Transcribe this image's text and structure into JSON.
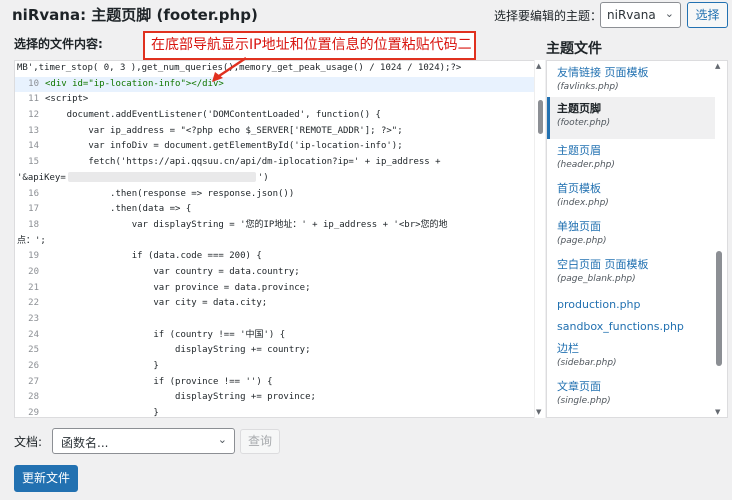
{
  "header": {
    "title": "niRvana: 主题页脚 (footer.php)",
    "theme_select_label": "选择要编辑的主题：",
    "theme_selected": "niRvana",
    "select_button": "选择"
  },
  "editor": {
    "content_label": "选择的文件内容:",
    "annotation": "在底部导航显示IP地址和位置信息的位置粘贴代码二",
    "lines": [
      {
        "num": "",
        "code": "MB',timer_stop( 0, 3 ),get_num_queries(),memory_get_peak_usage() / 1024 / 1024);?>"
      },
      {
        "num": "10",
        "code": "<div id=\"ip-location-info\"></div>",
        "active": true
      },
      {
        "num": "11",
        "code": "<script>"
      },
      {
        "num": "12",
        "code": "    document.addEventListener('DOMContentLoaded', function() {"
      },
      {
        "num": "13",
        "code": "        var ip_address = \"<?php echo $_SERVER['REMOTE_ADDR']; ?>\";"
      },
      {
        "num": "14",
        "code": "        var infoDiv = document.getElementById('ip-location-info');"
      },
      {
        "num": "15",
        "code": "        fetch('https://api.qqsuu.cn/api/dm-iplocation?ip=' + ip_address +"
      },
      {
        "num": "",
        "code": "'&apiKey=",
        "code2": "')",
        "blurred": true
      },
      {
        "num": "16",
        "code": "            .then(response => response.json())"
      },
      {
        "num": "17",
        "code": "            .then(data => {"
      },
      {
        "num": "18",
        "code": "                var displayString = '您的IP地址：' + ip_address + '<br>您的地"
      },
      {
        "num": "",
        "code": "点：';"
      },
      {
        "num": "19",
        "code": "                if (data.code === 200) {"
      },
      {
        "num": "20",
        "code": "                    var country = data.country;"
      },
      {
        "num": "21",
        "code": "                    var province = data.province;"
      },
      {
        "num": "22",
        "code": "                    var city = data.city;"
      },
      {
        "num": "23",
        "code": ""
      },
      {
        "num": "24",
        "code": "                    if (country !== '中国') {"
      },
      {
        "num": "25",
        "code": "                        displayString += country;"
      },
      {
        "num": "26",
        "code": "                    }"
      },
      {
        "num": "27",
        "code": "                    if (province !== '') {"
      },
      {
        "num": "28",
        "code": "                        displayString += province;"
      },
      {
        "num": "29",
        "code": "                    }"
      }
    ]
  },
  "files": {
    "heading": "主题文件",
    "items": [
      {
        "name": "友情链接 页面模板",
        "path": "(favlinks.php)"
      },
      {
        "name": "主题页脚",
        "path": "(footer.php)",
        "current": true
      },
      {
        "name": "主题页眉",
        "path": "(header.php)"
      },
      {
        "name": "首页模板",
        "path": "(index.php)"
      },
      {
        "name": "单独页面",
        "path": "(page.php)"
      },
      {
        "name": "空白页面 页面模板",
        "path": "(page_blank.php)"
      },
      {
        "name": "production.php",
        "path": ""
      },
      {
        "name": "sandbox_functions.php",
        "path": ""
      },
      {
        "name": "边栏",
        "path": "(sidebar.php)"
      },
      {
        "name": "文章页面",
        "path": "(single.php)"
      }
    ]
  },
  "footer": {
    "doc_label": "文档:",
    "function_placeholder": "函数名...",
    "lookup_button": "查询",
    "update_button": "更新文件"
  },
  "icons": {
    "dropdown": "chevron-down-icon",
    "scroll_up": "scroll-up-arrow-icon",
    "scroll_down": "scroll-down-arrow-icon",
    "annotation_arrow": "red-arrow-icon"
  },
  "colors": {
    "accent": "#2271b1",
    "annotation": "#e0311f",
    "active_line": "#e8f2fe"
  }
}
